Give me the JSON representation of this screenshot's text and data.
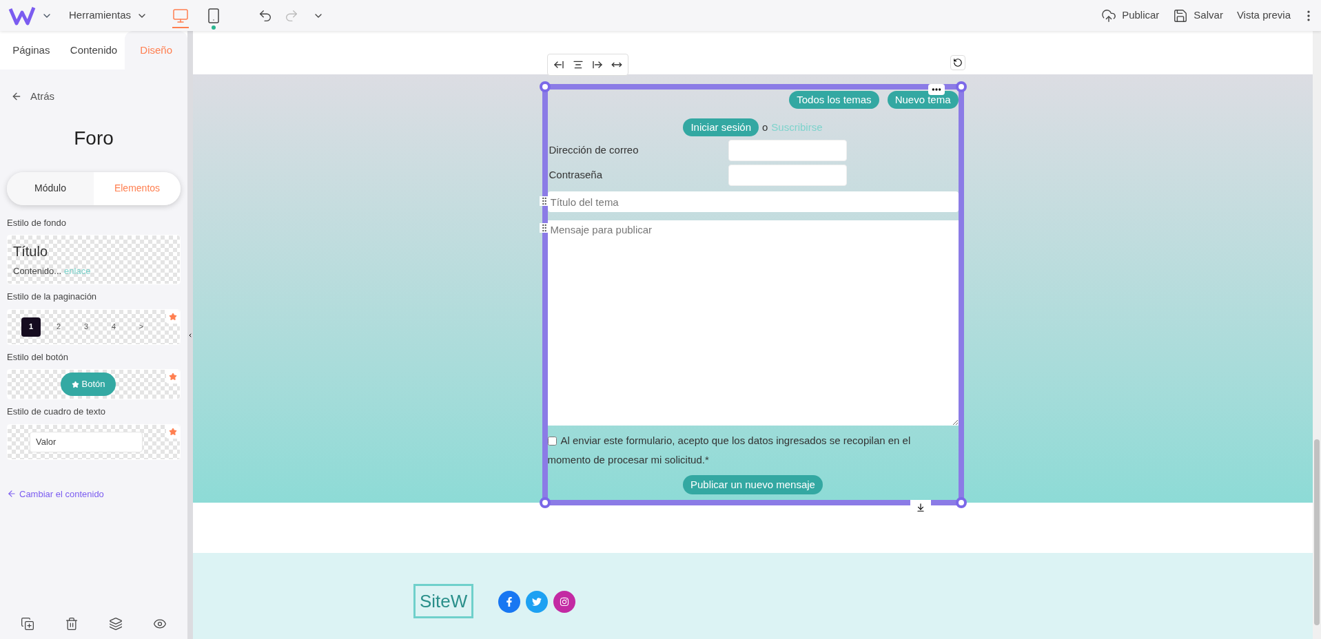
{
  "topbar": {
    "menu_label": "Herramientas",
    "devices": [
      {
        "kind": "desktop",
        "selected": true
      },
      {
        "kind": "mobile",
        "selected": false
      }
    ],
    "actions": [
      {
        "kind": "upload",
        "label": "Publicar"
      },
      {
        "kind": "save",
        "label": "Salvar"
      },
      {
        "kind": "preview",
        "label": "Vista previa"
      }
    ]
  },
  "sidebar": {
    "tabs": [
      {
        "label": "Páginas",
        "selected": false
      },
      {
        "label": "Contenido",
        "selected": false
      },
      {
        "label": "Diseño",
        "selected": true
      }
    ],
    "back_link": "Atrás",
    "title": "Foro",
    "segments": [
      {
        "label": "Módulo",
        "selected": false
      },
      {
        "label": "Elementos",
        "selected": true
      }
    ],
    "background_style": {
      "label": "Estilo de fondo",
      "preview_title": "Título",
      "preview_text": "Contenido...",
      "preview_link": "enlace"
    },
    "pagination_style": {
      "label": "Estilo de la paginación",
      "pages": [
        {
          "label": "1",
          "selected": true
        },
        {
          "label": "2",
          "selected": false
        },
        {
          "label": "3",
          "selected": false
        },
        {
          "label": "4",
          "selected": false
        },
        {
          "label": ">",
          "selected": false
        }
      ]
    },
    "button_style": {
      "label": "Estilo del botón",
      "button": "Botón"
    },
    "textbox_style": {
      "label": "Estilo de cuadro de texto",
      "value": "Valor"
    },
    "change_link": "Cambiar el contenido"
  },
  "forum": {
    "top_buttons": [
      "Todos los temas",
      "Nuevo tema"
    ],
    "login_button": "Iniciar sesión",
    "or_text": "o",
    "signup_link": "Suscribirse",
    "fields": [
      {
        "label": "Dirección de correo"
      },
      {
        "label": "Contraseña"
      }
    ],
    "topic_placeholder": "Título del tema",
    "message_placeholder": "Mensaje para publicar",
    "consent": {
      "text": "Al enviar este formulario, acepto que los datos ingresados se recopilan en el momento de procesar mi solicitud.*",
      "checked": false
    },
    "submit": "Publicar un nuevo mensaje"
  },
  "footer": {
    "logo": "SiteW"
  }
}
